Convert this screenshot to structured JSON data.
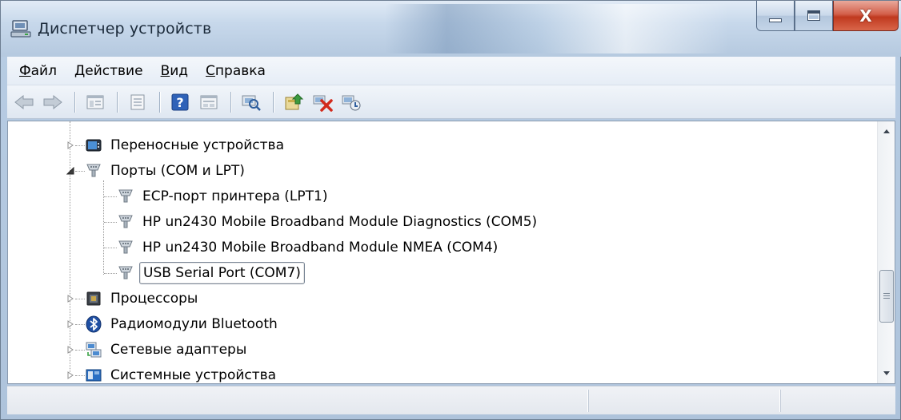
{
  "window": {
    "title": "Диспетчер устройств",
    "minimize_glyph": "",
    "maximize_glyph": "",
    "close_glyph": "X"
  },
  "menu": [
    {
      "accel": "Ф",
      "rest": "айл"
    },
    {
      "accel": "Д",
      "rest": "ействие"
    },
    {
      "accel": "В",
      "rest": "ид"
    },
    {
      "accel": "С",
      "rest": "правка"
    }
  ],
  "toolbar": {
    "buttons": [
      "back-arrow-icon",
      "forward-arrow-icon",
      "console-tree-icon",
      "properties-icon",
      "help-icon",
      "view-pane-icon",
      "scan-hardware-icon",
      "update-driver-icon",
      "disable-device-icon",
      "uninstall-device-icon"
    ]
  },
  "tree": {
    "portable": "Переносные устройства",
    "ports": "Порты (COM и LPT)",
    "port_children": [
      "ECP-порт принтера (LPT1)",
      "HP un2430 Mobile Broadband Module Diagnostics (COM5)",
      "HP un2430 Mobile Broadband Module NMEA (COM4)",
      "USB Serial Port (COM7)"
    ],
    "processors": "Процессоры",
    "bluetooth": "Радиомодули Bluetooth",
    "network": "Сетевые адаптеры",
    "system": "Системные устройства"
  },
  "colors": {
    "titlebar": "#c7d8eb",
    "close_button": "#c0391f",
    "selection_border": "#7a8696"
  }
}
